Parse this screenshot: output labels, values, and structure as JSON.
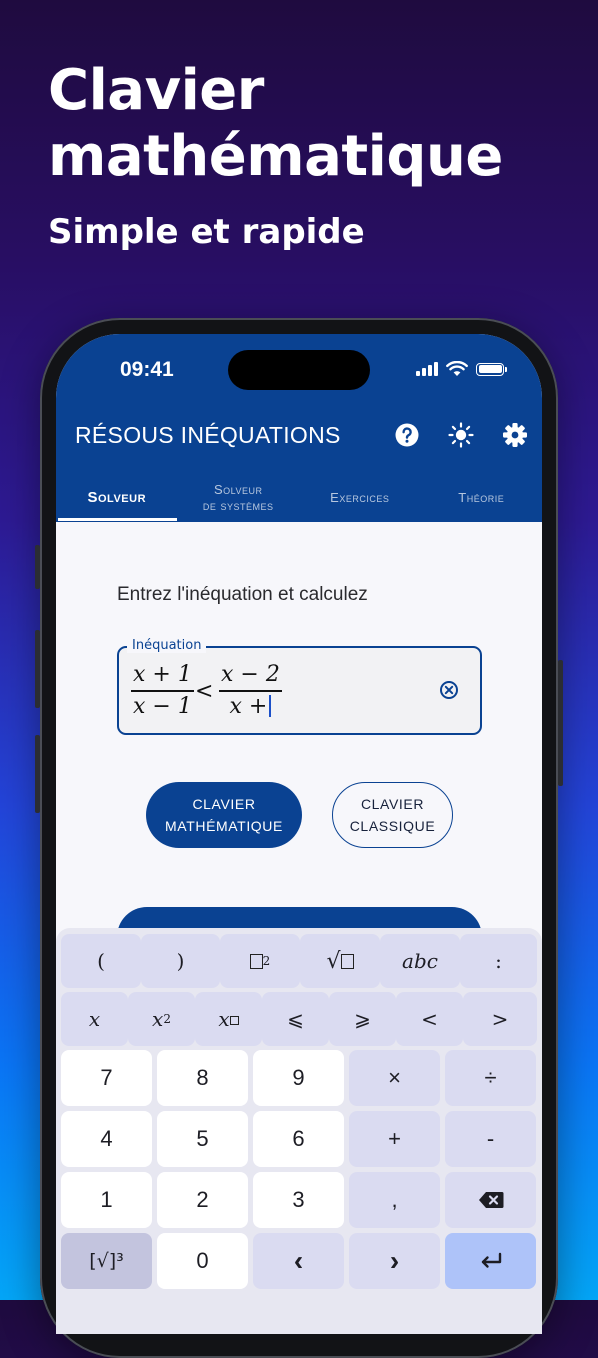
{
  "promo": {
    "title": "Clavier mathématique",
    "subtitle": "Simple et rapide"
  },
  "status_bar": {
    "time": "09:41"
  },
  "app_bar": {
    "title": "RÉSOUS INÉQUATIONS",
    "actions": [
      "help-icon",
      "brightness-icon",
      "settings-icon"
    ]
  },
  "tabs": [
    {
      "label": "Solveur",
      "active": true
    },
    {
      "label_line1": "Solveur",
      "label_line2": "de systèmes",
      "active": false
    },
    {
      "label": "Exercices",
      "active": false
    },
    {
      "label": "Théorie",
      "active": false
    }
  ],
  "main": {
    "prompt": "Entrez l'inéquation et calculez",
    "field_label": "Inéquation",
    "expression": {
      "left_num": "x + 1",
      "left_den": "x − 1",
      "operator": "<",
      "right_num": "x − 2",
      "right_den": "x +"
    },
    "keyboard_buttons": {
      "math_line1": "CLAVIER",
      "math_line2": "MATHÉMATIQUE",
      "classic_line1": "CLAVIER",
      "classic_line2": "CLASSIQUE"
    }
  },
  "keyboard": {
    "row1": [
      "(",
      ")",
      "□²",
      "√□",
      "abc",
      ":"
    ],
    "row2": [
      "x",
      "x²",
      "x□",
      "⩽",
      "⩾",
      "<",
      ">"
    ],
    "row3": [
      "7",
      "8",
      "9",
      "×",
      "÷"
    ],
    "row4": [
      "4",
      "5",
      "6",
      "+",
      "-"
    ],
    "row5": [
      "1",
      "2",
      "3",
      ",",
      "backspace-icon"
    ],
    "row6": [
      "[√]³",
      "0",
      "‹",
      "›",
      "enter-icon"
    ]
  },
  "colors": {
    "primary": "#0a4292",
    "keyboard_bg": "#e7e7f1",
    "symbol_key": "#dadbf1",
    "enter_key": "#aec3f9"
  }
}
